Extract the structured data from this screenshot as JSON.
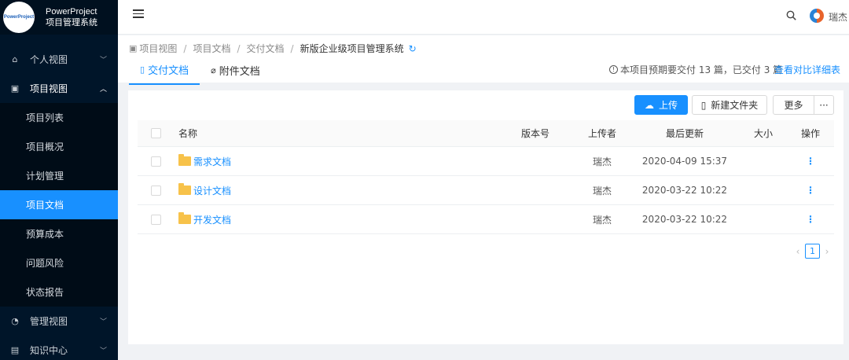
{
  "brand": {
    "logo_text": "PowerProject",
    "title_line1": "PowerProject",
    "title_line2": "项目管理系统"
  },
  "sidebar": {
    "items": [
      {
        "label": "个人视图",
        "icon": "home-icon"
      },
      {
        "label": "项目视图",
        "icon": "project-icon",
        "expanded": true,
        "children": [
          {
            "label": "项目列表"
          },
          {
            "label": "项目概况"
          },
          {
            "label": "计划管理"
          },
          {
            "label": "项目文档",
            "active": true
          },
          {
            "label": "预算成本"
          },
          {
            "label": "问题风险"
          },
          {
            "label": "状态报告"
          }
        ]
      },
      {
        "label": "管理视图",
        "icon": "dashboard-icon"
      },
      {
        "label": "知识中心",
        "icon": "book-icon"
      }
    ]
  },
  "header": {
    "user_name": "瑞杰"
  },
  "breadcrumb": [
    "项目视图",
    "项目文档",
    "交付文档",
    "新版企业级项目管理系统"
  ],
  "tabs": [
    {
      "label": "交付文档",
      "active": true
    },
    {
      "label": "附件文档",
      "active": false
    }
  ],
  "delivery_info": "本项目预期要交付 13 篇，已交付 3 篇",
  "compare_link": "查看对比详细表",
  "toolbar": {
    "upload": "上传",
    "new_folder": "新建文件夹",
    "more": "更多",
    "dots": "···"
  },
  "table": {
    "columns": {
      "name": "名称",
      "version": "版本号",
      "uploader": "上传者",
      "updated": "最后更新",
      "size": "大小",
      "actions": "操作"
    },
    "rows": [
      {
        "name": "需求文档",
        "version": "",
        "uploader": "瑞杰",
        "updated": "2020-04-09 15:37",
        "size": ""
      },
      {
        "name": "设计文档",
        "version": "",
        "uploader": "瑞杰",
        "updated": "2020-03-22 10:22",
        "size": ""
      },
      {
        "name": "开发文档",
        "version": "",
        "uploader": "瑞杰",
        "updated": "2020-03-22 10:22",
        "size": ""
      }
    ],
    "row_action": "⋮"
  },
  "pagination": {
    "current_page": "1"
  },
  "colors": {
    "accent": "#1890ff",
    "sidebar_bg": "#001529",
    "folder": "#f7c24a"
  }
}
